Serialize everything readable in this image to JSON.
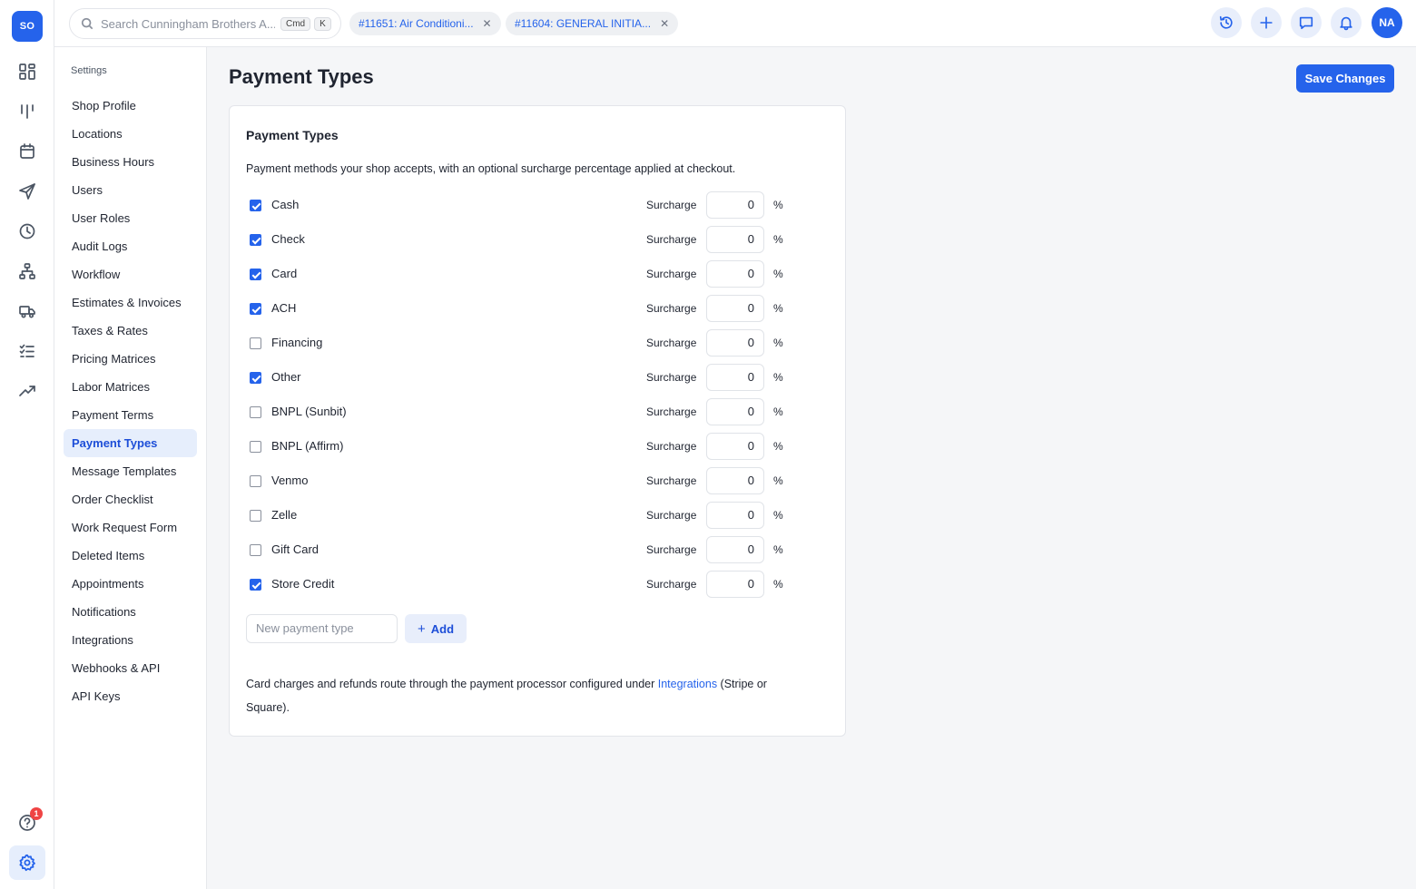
{
  "rail": {
    "logo": "SO",
    "help_badge": "1"
  },
  "search": {
    "placeholder": "Search Cunningham Brothers A...",
    "kbd_cmd": "Cmd",
    "kbd_k": "K"
  },
  "tabs": [
    {
      "label": "#11651: Air Conditioni..."
    },
    {
      "label": "#11604: GENERAL INITIA..."
    }
  ],
  "user": {
    "initials": "NA"
  },
  "settings_nav": {
    "title": "Settings",
    "items": [
      {
        "label": "Shop Profile"
      },
      {
        "label": "Locations"
      },
      {
        "label": "Business Hours"
      },
      {
        "label": "Users"
      },
      {
        "label": "User Roles"
      },
      {
        "label": "Audit Logs"
      },
      {
        "label": "Workflow"
      },
      {
        "label": "Estimates & Invoices"
      },
      {
        "label": "Taxes & Rates"
      },
      {
        "label": "Pricing Matrices"
      },
      {
        "label": "Labor Matrices"
      },
      {
        "label": "Payment Terms"
      },
      {
        "label": "Payment Types"
      },
      {
        "label": "Message Templates"
      },
      {
        "label": "Order Checklist"
      },
      {
        "label": "Work Request Form"
      },
      {
        "label": "Deleted Items"
      },
      {
        "label": "Appointments"
      },
      {
        "label": "Notifications"
      },
      {
        "label": "Integrations"
      },
      {
        "label": "Webhooks & API"
      },
      {
        "label": "API Keys"
      }
    ],
    "active": "Payment Types"
  },
  "page": {
    "title": "Payment Types",
    "save_label": "Save Changes"
  },
  "card": {
    "title": "Payment Types",
    "description": "Payment methods your shop accepts, with an optional surcharge percentage applied at checkout.",
    "surcharge_label": "Surcharge",
    "percent_sign": "%",
    "payment_types": [
      {
        "name": "Cash",
        "enabled": true,
        "surcharge": "0"
      },
      {
        "name": "Check",
        "enabled": true,
        "surcharge": "0"
      },
      {
        "name": "Card",
        "enabled": true,
        "surcharge": "0"
      },
      {
        "name": "ACH",
        "enabled": true,
        "surcharge": "0"
      },
      {
        "name": "Financing",
        "enabled": false,
        "surcharge": "0"
      },
      {
        "name": "Other",
        "enabled": true,
        "surcharge": "0"
      },
      {
        "name": "BNPL (Sunbit)",
        "enabled": false,
        "surcharge": "0"
      },
      {
        "name": "BNPL (Affirm)",
        "enabled": false,
        "surcharge": "0"
      },
      {
        "name": "Venmo",
        "enabled": false,
        "surcharge": "0"
      },
      {
        "name": "Zelle",
        "enabled": false,
        "surcharge": "0"
      },
      {
        "name": "Gift Card",
        "enabled": false,
        "surcharge": "0"
      },
      {
        "name": "Store Credit",
        "enabled": true,
        "surcharge": "0"
      }
    ],
    "new_placeholder": "New payment type",
    "add_label": "Add",
    "footer_pre": "Card charges and refunds route through the payment processor configured under ",
    "footer_link": "Integrations",
    "footer_post": " (Stripe or Square)."
  },
  "colors": {
    "accent": "#2563eb",
    "accent_soft": "#e6eefc",
    "badge_red": "#ef4444"
  }
}
